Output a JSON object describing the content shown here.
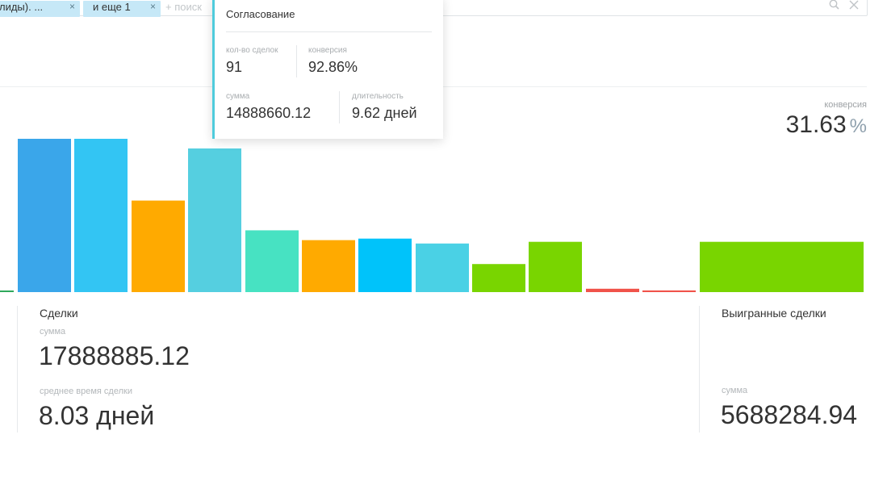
{
  "filters": {
    "chips": [
      {
        "label": "лиды). ..."
      },
      {
        "label": "и еще 1"
      }
    ],
    "chip_close": "×",
    "search_placeholder": "+ поиск",
    "search_icon": "search-icon",
    "clear_icon": "close-icon"
  },
  "tooltip": {
    "title": "Согласование",
    "deals_count_label": "кол-во сделок",
    "deals_count": "91",
    "conversion_label": "конверсия",
    "conversion": "92.86%",
    "sum_label": "сумма",
    "sum": "14888660.12",
    "duration_label": "длительность",
    "duration": "9.62 дней",
    "accent_color": "#4fcbdc"
  },
  "conversion": {
    "label": "конверсия",
    "value": "31.63",
    "unit": "%"
  },
  "chart_data": {
    "type": "bar",
    "values": [
      0.7,
      100,
      100,
      59.7,
      93.7,
      40.3,
      33.9,
      34.9,
      31.7,
      18.3,
      32.8,
      2.2,
      1.1,
      32.8
    ],
    "colors": [
      "#2fa85c",
      "#3aa6ea",
      "#33c5f3",
      "#ffaa00",
      "#55cfe0",
      "#47e2c2",
      "#ffaa00",
      "#00c3fa",
      "#4ad1e5",
      "#79d500",
      "#79d500",
      "#f0534a",
      "#f0534a",
      "#79d500"
    ],
    "ylim": [
      0,
      100
    ]
  },
  "deals": {
    "title": "Сделки",
    "sum_label": "сумма",
    "sum": "17888885.12",
    "avg_time_label": "среднее время сделки",
    "avg_time": "8.03 дней"
  },
  "won": {
    "title": "Выигранные сделки",
    "sum_label": "сумма",
    "sum": "5688284.94"
  }
}
